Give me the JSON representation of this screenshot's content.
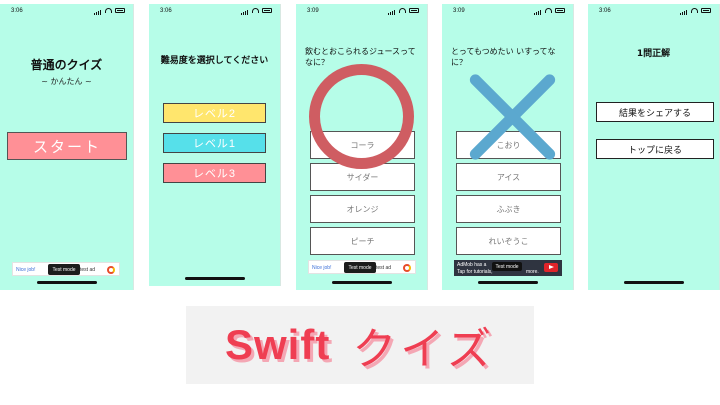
{
  "status": {
    "time": "3:06",
    "time_quiz": "3:09"
  },
  "screen1": {
    "title": "普通のクイズ",
    "subtitle": "~ かんたん ~",
    "start_label": "スタート"
  },
  "screen2": {
    "title": "難易度を選択してください",
    "levels": [
      {
        "label": "レベル2",
        "color": "#ffe66d"
      },
      {
        "label": "レベル1",
        "color": "#56e0ea"
      },
      {
        "label": "レベル3",
        "color": "#ff9096"
      }
    ]
  },
  "screen3": {
    "question": "飲むとおこられるジュースってなに？",
    "answers": [
      "コーラ",
      "サイダー",
      "オレンジ",
      "ピーチ"
    ],
    "feedback_color": "#cf5d62"
  },
  "screen4": {
    "question": "とってもつめたい いすってなに？",
    "answers": [
      "こおり",
      "アイス",
      "ふぶき",
      "れいぞうこ"
    ],
    "feedback_color": "#5ba8cf",
    "ad_line1": "AdMob has a",
    "ad_line2": "Tap for tutorials,",
    "ad_more": "more."
  },
  "screen5": {
    "title": "1問正解",
    "share_label": "結果をシェアする",
    "top_label": "トップに戻る"
  },
  "ad": {
    "nice": "Nice job!",
    "test_mode": "Test mode",
    "test_ad": "test ad"
  },
  "banner": {
    "swift": "Swift",
    "quiz": "クイズ",
    "color": "#ef3e52"
  }
}
